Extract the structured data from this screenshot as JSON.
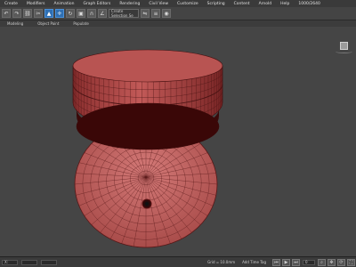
{
  "menu": [
    "Create",
    "Modifiers",
    "Animation",
    "Graph Editors",
    "Rendering",
    "Civil View",
    "Customize",
    "Scripting",
    "Content",
    "Arnold",
    "Help",
    "1000/2640"
  ],
  "toolbar": {
    "selection_set": "Create Selection Se",
    "icons": [
      "undo-icon",
      "redo-icon",
      "link-icon",
      "unlink-icon",
      "select-icon",
      "move-icon",
      "rotate-icon",
      "scale-icon",
      "snap-icon",
      "angle-snap-icon",
      "mirror-icon",
      "align-icon",
      "render-icon"
    ]
  },
  "ribbon": {
    "tabs": [
      "Modeling",
      "Object Paint",
      "Populate"
    ]
  },
  "viewport": {
    "label": "",
    "object_color": "#c0605e",
    "background": "#454545"
  },
  "status": {
    "coordinates": "X: ",
    "grid": "Grid = 10.0mm",
    "add_time_tag": "Add Time Tag",
    "frame": "0"
  }
}
